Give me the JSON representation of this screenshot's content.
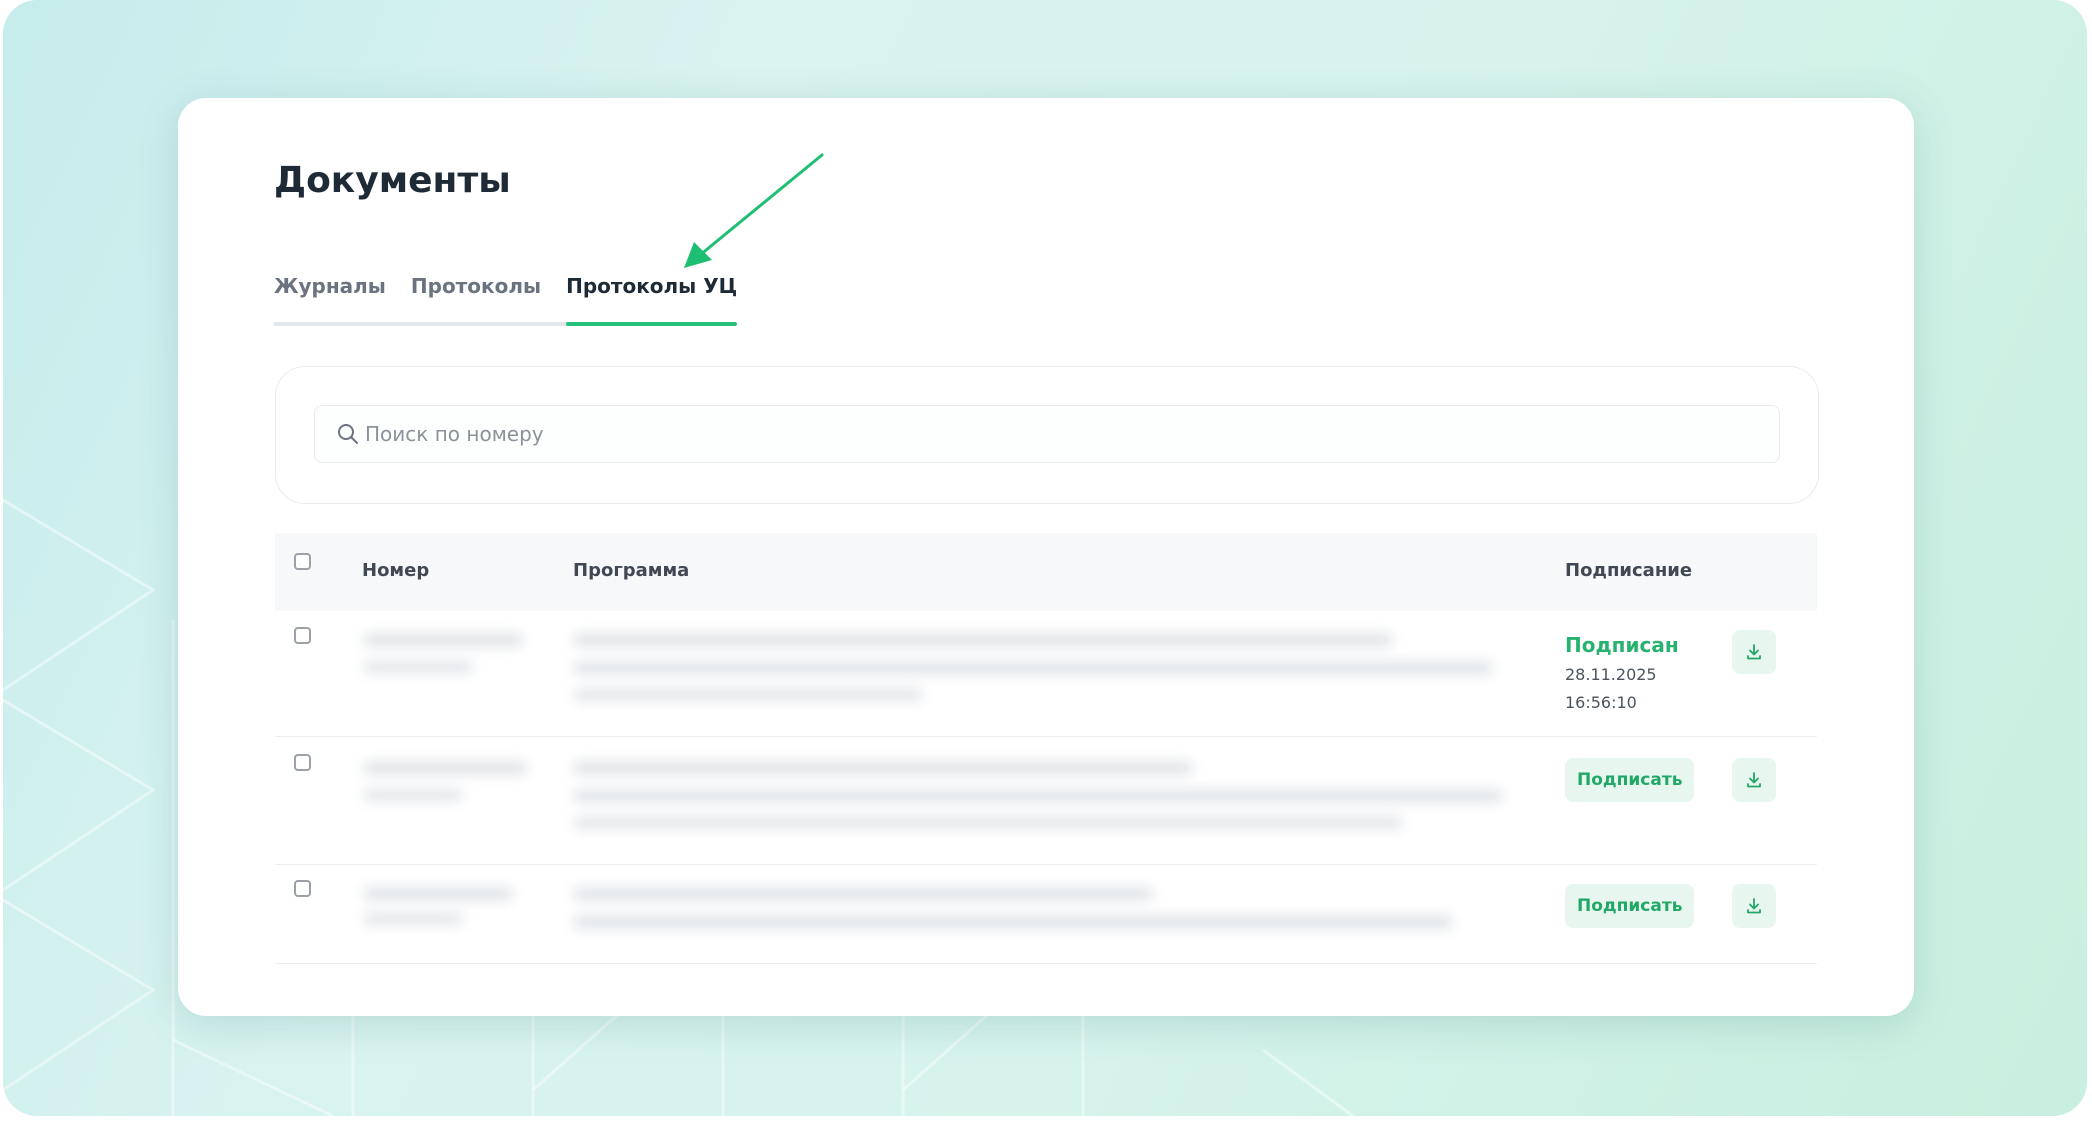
{
  "page": {
    "title": "Документы"
  },
  "tabs": [
    {
      "label": "Журналы",
      "active": false
    },
    {
      "label": "Протоколы",
      "active": false
    },
    {
      "label": "Протоколы УЦ",
      "active": true
    }
  ],
  "search": {
    "placeholder": "Поиск по номеру",
    "value": ""
  },
  "table": {
    "columns": {
      "number": "Номер",
      "program": "Программа",
      "signing": "Подписание"
    },
    "rows": [
      {
        "status": "signed",
        "status_label": "Подписан",
        "date": "28.11.2025",
        "time": "16:56:10"
      },
      {
        "status": "unsigned",
        "sign_label": "Подписать"
      },
      {
        "status": "unsigned",
        "sign_label": "Подписать"
      }
    ]
  },
  "icons": {
    "search": "search-icon",
    "download": "download-icon",
    "annotation": "annotation-arrow-icon"
  },
  "colors": {
    "accent": "#27c07a",
    "signed_text": "#27b26f",
    "button_bg": "#e7f6ee",
    "title": "#1f2a37",
    "annotation_arrow": "#1fbf73"
  }
}
